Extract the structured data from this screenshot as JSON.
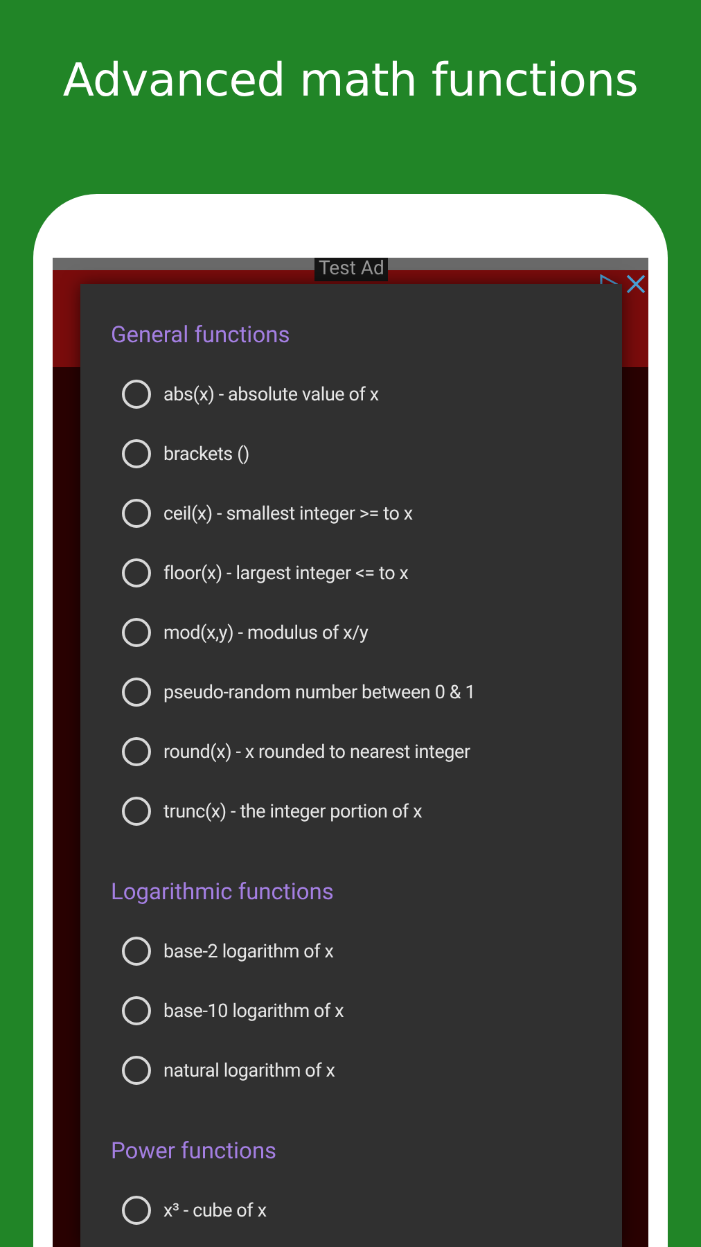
{
  "headline": "Advanced math functions",
  "ad": {
    "label": "Test Ad"
  },
  "sections": [
    {
      "title": "General functions",
      "options": [
        {
          "label": "abs(x) - absolute value of x",
          "selected": false
        },
        {
          "label": "brackets ()",
          "selected": false
        },
        {
          "label": "ceil(x) - smallest integer >= to x",
          "selected": false
        },
        {
          "label": "floor(x) - largest integer <= to x",
          "selected": false
        },
        {
          "label": "mod(x,y) - modulus of x/y",
          "selected": false
        },
        {
          "label": "pseudo-random number between 0 & 1",
          "selected": false
        },
        {
          "label": "round(x) - x rounded to nearest integer",
          "selected": false
        },
        {
          "label": "trunc(x) - the integer portion of x",
          "selected": false
        }
      ]
    },
    {
      "title": "Logarithmic functions",
      "options": [
        {
          "label": "base-2 logarithm of x",
          "selected": false
        },
        {
          "label": "base-10 logarithm of x",
          "selected": false
        },
        {
          "label": "natural logarithm of x",
          "selected": false
        }
      ]
    },
    {
      "title": "Power functions",
      "options": [
        {
          "label": "x³ - cube of x",
          "selected": false
        }
      ]
    }
  ]
}
